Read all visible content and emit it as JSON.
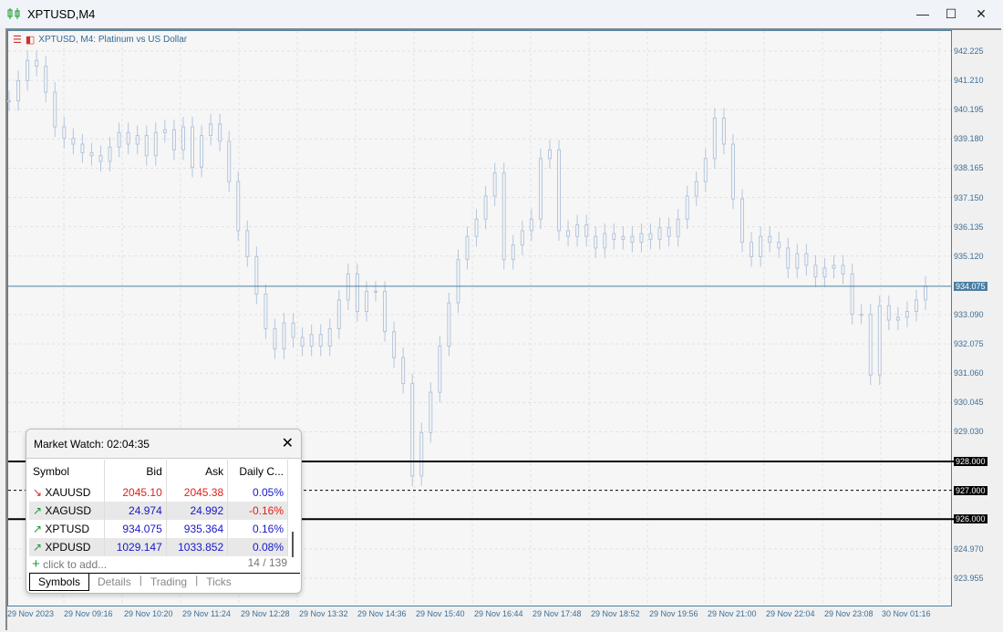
{
  "window": {
    "title": "XPTUSD,M4",
    "minimize": "—",
    "maximize": "☐",
    "close": "✕"
  },
  "chart": {
    "legend": "XPTUSD, M4:  Platinum vs US Dollar",
    "colors": {
      "candle": "#b4c6dc",
      "bid_line": "#4a7fa3",
      "level_line": "#000000"
    },
    "price_labels": [
      "942.225",
      "941.210",
      "940.195",
      "939.180",
      "938.165",
      "937.150",
      "936.135",
      "935.120",
      "933.090",
      "932.075",
      "931.060",
      "930.045",
      "929.030",
      "924.970",
      "923.955"
    ],
    "price_values": [
      942.225,
      941.21,
      940.195,
      939.18,
      938.165,
      937.15,
      936.135,
      935.12,
      933.09,
      932.075,
      931.06,
      930.045,
      929.03,
      924.97,
      923.955
    ],
    "bid_label": "934.075",
    "levels": [
      {
        "label": "928.000",
        "value": 928,
        "style": "solid"
      },
      {
        "label": "927.000",
        "value": 927,
        "style": "dashed"
      },
      {
        "label": "926.000",
        "value": 926,
        "style": "solid"
      }
    ],
    "time_labels": [
      "29 Nov 2023",
      "29 Nov 09:16",
      "29 Nov 10:20",
      "29 Nov 11:24",
      "29 Nov 12:28",
      "29 Nov 13:32",
      "29 Nov 14:36",
      "29 Nov 15:40",
      "29 Nov 16:44",
      "29 Nov 17:48",
      "29 Nov 18:52",
      "29 Nov 19:56",
      "29 Nov 21:00",
      "29 Nov 22:04",
      "29 Nov 23:08",
      "30 Nov 01:16"
    ]
  },
  "chart_data": {
    "type": "candlestick",
    "symbol": "XPTUSD",
    "timeframe": "M4",
    "ylim": [
      923.955,
      942.225
    ],
    "closes": [
      940.5,
      941.2,
      941.9,
      941.7,
      940.8,
      939.6,
      939.2,
      939.0,
      938.7,
      938.6,
      938.4,
      938.9,
      939.4,
      939.0,
      939.3,
      938.6,
      939.4,
      939.5,
      938.8,
      939.6,
      938.2,
      939.3,
      939.7,
      939.1,
      937.7,
      936.0,
      935.1,
      933.8,
      932.6,
      931.9,
      932.8,
      932.3,
      932.0,
      932.4,
      932.0,
      932.6,
      933.6,
      934.5,
      933.2,
      933.9,
      933.9,
      932.5,
      931.6,
      930.7,
      927.5,
      929.0,
      930.4,
      932.0,
      933.5,
      935.0,
      935.8,
      936.4,
      937.2,
      938.0,
      935.0,
      935.5,
      936.0,
      936.4,
      938.5,
      938.8,
      936.0,
      935.8,
      936.2,
      935.8,
      935.4,
      935.9,
      935.7,
      935.8,
      935.6,
      935.9,
      935.7,
      936.1,
      935.8,
      936.4,
      937.2,
      937.7,
      938.5,
      939.9,
      939.0,
      937.1,
      935.6,
      935.1,
      935.8,
      935.6,
      935.4,
      934.7,
      935.2,
      934.8,
      934.4,
      934.7,
      934.8,
      934.5,
      933.1,
      933.1,
      931.0,
      933.4,
      932.9,
      933.0,
      933.2,
      933.6,
      934.075
    ]
  },
  "market_watch": {
    "title": "Market Watch: 02:04:35",
    "close": "✕",
    "columns": [
      "Symbol",
      "Bid",
      "Ask",
      "Daily C..."
    ],
    "rows": [
      {
        "dir": "down",
        "arrow": "↘",
        "symbol": "XAUUSD",
        "bid": "2045.10",
        "ask": "2045.38",
        "change": "0.05%"
      },
      {
        "dir": "up",
        "arrow": "↗",
        "symbol": "XAGUSD",
        "bid": "24.974",
        "ask": "24.992",
        "change": "-0.16%"
      },
      {
        "dir": "up",
        "arrow": "↗",
        "symbol": "XPTUSD",
        "bid": "934.075",
        "ask": "935.364",
        "change": "0.16%"
      },
      {
        "dir": "up",
        "arrow": "↗",
        "symbol": "XPDUSD",
        "bid": "1029.147",
        "ask": "1033.852",
        "change": "0.08%"
      }
    ],
    "add_label": "click to add...",
    "add_icon": "+",
    "count": "14 / 139",
    "tabs": [
      "Symbols",
      "Details",
      "Trading",
      "Ticks"
    ]
  }
}
